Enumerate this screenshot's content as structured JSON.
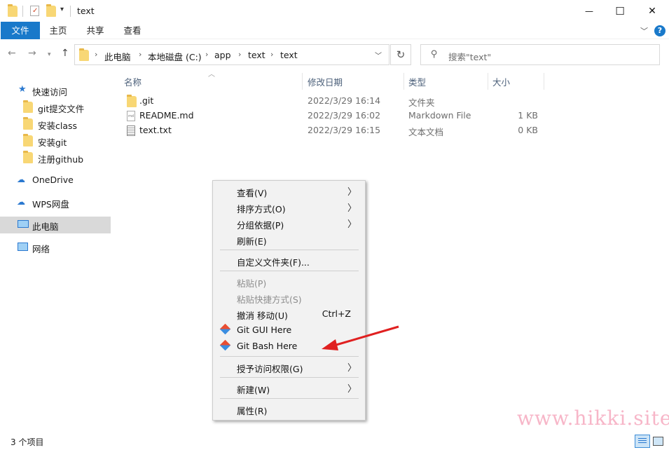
{
  "window": {
    "title": "text",
    "minimize_glyph": "—",
    "maximize_glyph": "☐",
    "close_glyph": "✕"
  },
  "ribbon": {
    "tabs": [
      "文件",
      "主页",
      "共享",
      "查看"
    ],
    "accent": "#1979ca"
  },
  "address": {
    "crumbs": [
      "此电脑",
      "本地磁盘 (C:)",
      "app",
      "text",
      "text"
    ]
  },
  "search": {
    "placeholder": "搜索\"text\""
  },
  "sidebar": {
    "items": [
      {
        "label": "快速访问",
        "icon": "star-icon"
      },
      {
        "label": "git提交文件",
        "icon": "folder-icon"
      },
      {
        "label": "安装class",
        "icon": "folder-icon"
      },
      {
        "label": "安装git",
        "icon": "folder-icon"
      },
      {
        "label": "注册github",
        "icon": "folder-icon"
      },
      {
        "label": "OneDrive",
        "icon": "cloud-icon"
      },
      {
        "label": "WPS网盘",
        "icon": "cloud-icon"
      },
      {
        "label": "此电脑",
        "icon": "computer-icon",
        "selected": true
      },
      {
        "label": "网络",
        "icon": "network-icon"
      }
    ]
  },
  "columns": [
    "名称",
    "修改日期",
    "类型",
    "大小"
  ],
  "files": [
    {
      "name": ".git",
      "date": "2022/3/29 16:14",
      "type": "文件夹",
      "size": "",
      "icon": "folder-icon"
    },
    {
      "name": "README.md",
      "date": "2022/3/29 16:02",
      "type": "Markdown File",
      "size": "1 KB",
      "icon": "markdown-file-icon"
    },
    {
      "name": "text.txt",
      "date": "2022/3/29 16:15",
      "type": "文本文档",
      "size": "0 KB",
      "icon": "text-file-icon"
    }
  ],
  "context_menu": {
    "items": [
      {
        "label": "查看(V)",
        "submenu": true
      },
      {
        "label": "排序方式(O)",
        "submenu": true
      },
      {
        "label": "分组依据(P)",
        "submenu": true
      },
      {
        "label": "刷新(E)"
      },
      {
        "label": "自定义文件夹(F)..."
      },
      {
        "label": "粘贴(P)",
        "disabled": true
      },
      {
        "label": "粘贴快捷方式(S)",
        "disabled": true
      },
      {
        "label": "撤消 移动(U)",
        "shortcut": "Ctrl+Z"
      },
      {
        "label": "Git GUI Here",
        "icon": "git-icon"
      },
      {
        "label": "Git Bash Here",
        "icon": "git-icon"
      },
      {
        "label": "授予访问权限(G)",
        "submenu": true
      },
      {
        "label": "新建(W)",
        "submenu": true
      },
      {
        "label": "属性(R)"
      }
    ],
    "arrow_color": "#e02020"
  },
  "status": {
    "text": "3 个项目"
  },
  "watermark": "www.hikki.site"
}
